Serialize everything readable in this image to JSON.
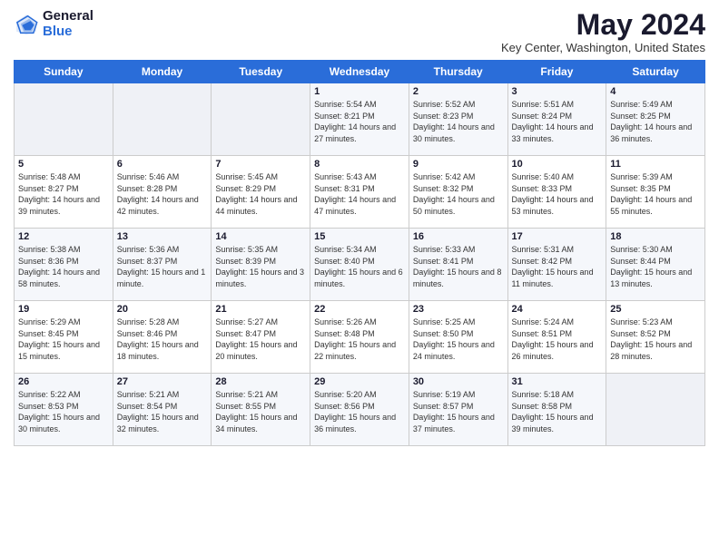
{
  "logo": {
    "general": "General",
    "blue": "Blue"
  },
  "title": "May 2024",
  "location": "Key Center, Washington, United States",
  "days_of_week": [
    "Sunday",
    "Monday",
    "Tuesday",
    "Wednesday",
    "Thursday",
    "Friday",
    "Saturday"
  ],
  "weeks": [
    [
      {
        "day": "",
        "info": ""
      },
      {
        "day": "",
        "info": ""
      },
      {
        "day": "",
        "info": ""
      },
      {
        "day": "1",
        "info": "Sunrise: 5:54 AM\nSunset: 8:21 PM\nDaylight: 14 hours and 27 minutes."
      },
      {
        "day": "2",
        "info": "Sunrise: 5:52 AM\nSunset: 8:23 PM\nDaylight: 14 hours and 30 minutes."
      },
      {
        "day": "3",
        "info": "Sunrise: 5:51 AM\nSunset: 8:24 PM\nDaylight: 14 hours and 33 minutes."
      },
      {
        "day": "4",
        "info": "Sunrise: 5:49 AM\nSunset: 8:25 PM\nDaylight: 14 hours and 36 minutes."
      }
    ],
    [
      {
        "day": "5",
        "info": "Sunrise: 5:48 AM\nSunset: 8:27 PM\nDaylight: 14 hours and 39 minutes."
      },
      {
        "day": "6",
        "info": "Sunrise: 5:46 AM\nSunset: 8:28 PM\nDaylight: 14 hours and 42 minutes."
      },
      {
        "day": "7",
        "info": "Sunrise: 5:45 AM\nSunset: 8:29 PM\nDaylight: 14 hours and 44 minutes."
      },
      {
        "day": "8",
        "info": "Sunrise: 5:43 AM\nSunset: 8:31 PM\nDaylight: 14 hours and 47 minutes."
      },
      {
        "day": "9",
        "info": "Sunrise: 5:42 AM\nSunset: 8:32 PM\nDaylight: 14 hours and 50 minutes."
      },
      {
        "day": "10",
        "info": "Sunrise: 5:40 AM\nSunset: 8:33 PM\nDaylight: 14 hours and 53 minutes."
      },
      {
        "day": "11",
        "info": "Sunrise: 5:39 AM\nSunset: 8:35 PM\nDaylight: 14 hours and 55 minutes."
      }
    ],
    [
      {
        "day": "12",
        "info": "Sunrise: 5:38 AM\nSunset: 8:36 PM\nDaylight: 14 hours and 58 minutes."
      },
      {
        "day": "13",
        "info": "Sunrise: 5:36 AM\nSunset: 8:37 PM\nDaylight: 15 hours and 1 minute."
      },
      {
        "day": "14",
        "info": "Sunrise: 5:35 AM\nSunset: 8:39 PM\nDaylight: 15 hours and 3 minutes."
      },
      {
        "day": "15",
        "info": "Sunrise: 5:34 AM\nSunset: 8:40 PM\nDaylight: 15 hours and 6 minutes."
      },
      {
        "day": "16",
        "info": "Sunrise: 5:33 AM\nSunset: 8:41 PM\nDaylight: 15 hours and 8 minutes."
      },
      {
        "day": "17",
        "info": "Sunrise: 5:31 AM\nSunset: 8:42 PM\nDaylight: 15 hours and 11 minutes."
      },
      {
        "day": "18",
        "info": "Sunrise: 5:30 AM\nSunset: 8:44 PM\nDaylight: 15 hours and 13 minutes."
      }
    ],
    [
      {
        "day": "19",
        "info": "Sunrise: 5:29 AM\nSunset: 8:45 PM\nDaylight: 15 hours and 15 minutes."
      },
      {
        "day": "20",
        "info": "Sunrise: 5:28 AM\nSunset: 8:46 PM\nDaylight: 15 hours and 18 minutes."
      },
      {
        "day": "21",
        "info": "Sunrise: 5:27 AM\nSunset: 8:47 PM\nDaylight: 15 hours and 20 minutes."
      },
      {
        "day": "22",
        "info": "Sunrise: 5:26 AM\nSunset: 8:48 PM\nDaylight: 15 hours and 22 minutes."
      },
      {
        "day": "23",
        "info": "Sunrise: 5:25 AM\nSunset: 8:50 PM\nDaylight: 15 hours and 24 minutes."
      },
      {
        "day": "24",
        "info": "Sunrise: 5:24 AM\nSunset: 8:51 PM\nDaylight: 15 hours and 26 minutes."
      },
      {
        "day": "25",
        "info": "Sunrise: 5:23 AM\nSunset: 8:52 PM\nDaylight: 15 hours and 28 minutes."
      }
    ],
    [
      {
        "day": "26",
        "info": "Sunrise: 5:22 AM\nSunset: 8:53 PM\nDaylight: 15 hours and 30 minutes."
      },
      {
        "day": "27",
        "info": "Sunrise: 5:21 AM\nSunset: 8:54 PM\nDaylight: 15 hours and 32 minutes."
      },
      {
        "day": "28",
        "info": "Sunrise: 5:21 AM\nSunset: 8:55 PM\nDaylight: 15 hours and 34 minutes."
      },
      {
        "day": "29",
        "info": "Sunrise: 5:20 AM\nSunset: 8:56 PM\nDaylight: 15 hours and 36 minutes."
      },
      {
        "day": "30",
        "info": "Sunrise: 5:19 AM\nSunset: 8:57 PM\nDaylight: 15 hours and 37 minutes."
      },
      {
        "day": "31",
        "info": "Sunrise: 5:18 AM\nSunset: 8:58 PM\nDaylight: 15 hours and 39 minutes."
      },
      {
        "day": "",
        "info": ""
      }
    ]
  ]
}
